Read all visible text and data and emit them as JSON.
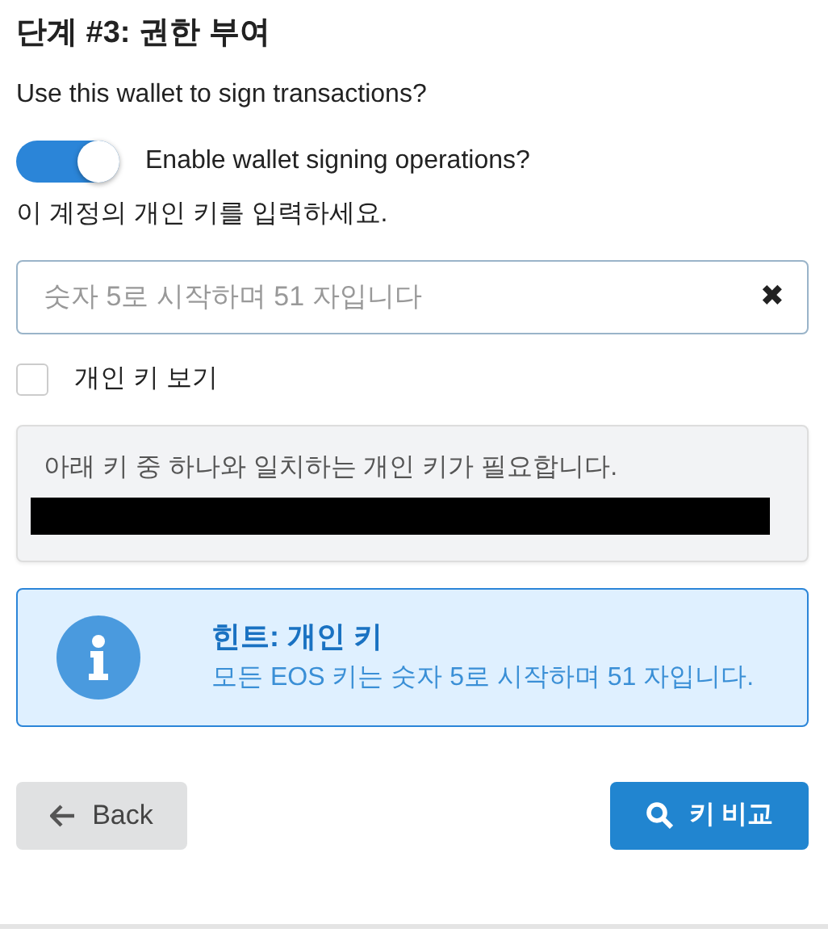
{
  "title": "단계 #3: 권한 부여",
  "question": "Use this wallet to sign transactions?",
  "toggle": {
    "label": "Enable wallet signing operations?",
    "on": true
  },
  "key_prompt": "이 계정의 개인 키를 입력하세요.",
  "key_field": {
    "placeholder": "숫자 5로 시작하며 51 자입니다",
    "clear": "✖"
  },
  "show_key": {
    "label": "개인 키 보기",
    "checked": false
  },
  "required_keys": {
    "text": "아래 키 중 하나와 일치하는 개인 키가 필요합니다.",
    "redacted": true
  },
  "hint": {
    "title": "힌트: 개인 키",
    "text": "모든 EOS 키는 숫자 5로 시작하며 51 자입니다."
  },
  "buttons": [
    {
      "kind": "back",
      "label": "Back"
    },
    {
      "kind": "compare",
      "label": "키 비교"
    }
  ]
}
